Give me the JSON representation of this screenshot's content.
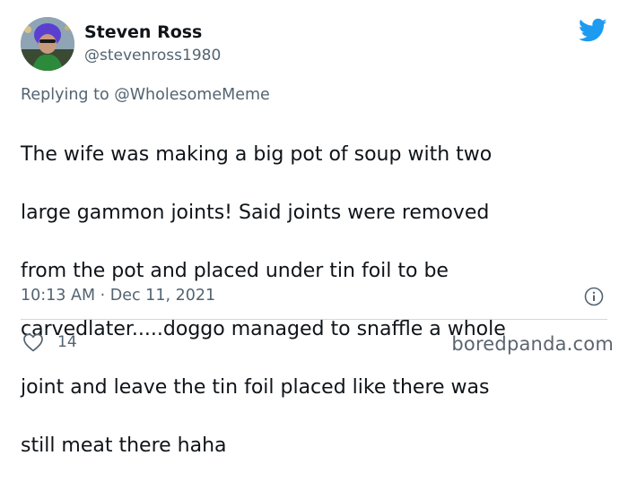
{
  "author": {
    "name": "Steven Ross",
    "handle": "@stevenross1980",
    "avatar_icon": "profile-photo"
  },
  "brand": {
    "icon": "twitter-bird-icon",
    "color": "#1d9bf0"
  },
  "reply": {
    "prefix": "Replying to",
    "target": "@WholesomeMeme"
  },
  "tweet": {
    "lines": [
      "The wife was making a big pot of soup with two",
      "large gammon joints! Said joints were removed",
      "from the pot and placed under tin foil to be",
      "carvedlater.....doggo managed to snaffle a whole",
      "joint and leave the tin foil placed like there was",
      "still meat there haha"
    ]
  },
  "meta": {
    "timestamp": "10:13 AM · Dec 11, 2021",
    "info_icon": "info-icon"
  },
  "engagement": {
    "likes": "14",
    "like_icon": "heart-icon"
  },
  "watermark": "boredpanda.com"
}
